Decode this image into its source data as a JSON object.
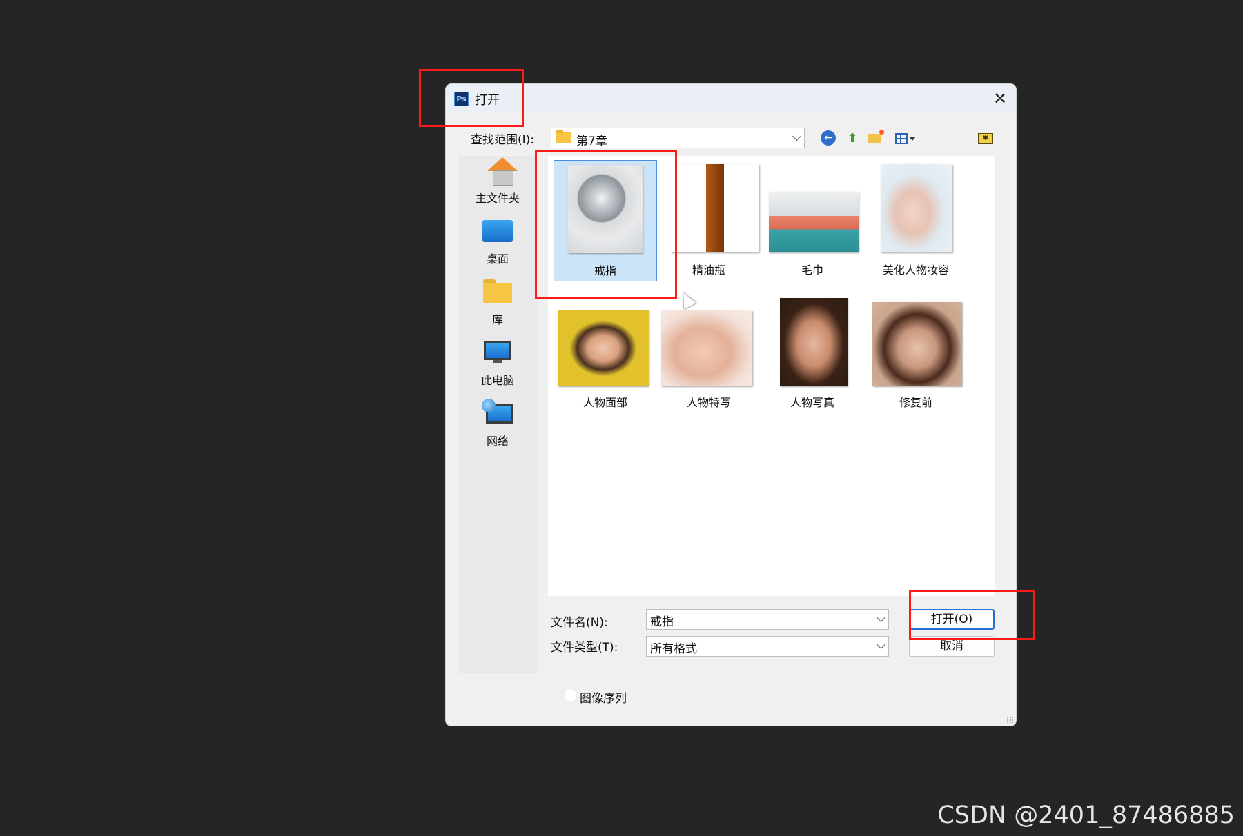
{
  "window": {
    "title": "打开",
    "app_icon_text": "Ps"
  },
  "toolbar": {
    "lookin_label": "查找范围(I):",
    "lookin_value": "第7章"
  },
  "places": [
    {
      "label": "主文件夹",
      "icon": "home-icon"
    },
    {
      "label": "桌面",
      "icon": "desktop-icon"
    },
    {
      "label": "库",
      "icon": "library-icon"
    },
    {
      "label": "此电脑",
      "icon": "computer-icon"
    },
    {
      "label": "网络",
      "icon": "network-icon"
    }
  ],
  "files": [
    {
      "name": "戒指",
      "selected": true
    },
    {
      "name": "精油瓶",
      "selected": false
    },
    {
      "name": "毛巾",
      "selected": false
    },
    {
      "name": "美化人物妆容",
      "selected": false
    },
    {
      "name": "人物面部",
      "selected": false
    },
    {
      "name": "人物特写",
      "selected": false
    },
    {
      "name": "人物写真",
      "selected": false
    },
    {
      "name": "修复前",
      "selected": false
    }
  ],
  "form": {
    "filename_label": "文件名(N):",
    "filename_value": "戒指",
    "filetype_label": "文件类型(T):",
    "filetype_value": "所有格式",
    "open_button": "打开(O)",
    "cancel_button": "取消",
    "image_sequence_label": "图像序列",
    "image_sequence_checked": false
  },
  "watermark": "CSDN @2401_87486885",
  "colors": {
    "annotation_red": "#ff1a1a",
    "selection_blue": "#cce4f7",
    "accent_blue": "#2a6fd4"
  }
}
